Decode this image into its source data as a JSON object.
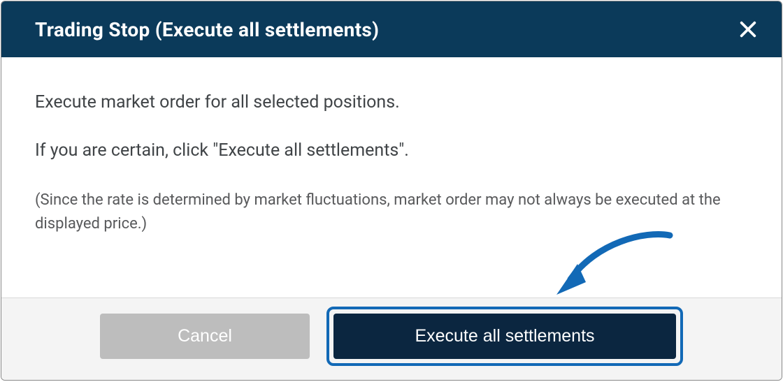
{
  "dialog": {
    "title": "Trading Stop (Execute all settlements)",
    "body": {
      "line1": "Execute market order for all selected positions.",
      "line2": "If you are certain, click \"Execute all settlements\".",
      "note": "(Since the rate is determined by market fluctuations, market order may not always be executed at the displayed price.)"
    },
    "footer": {
      "cancel": "Cancel",
      "confirm": "Execute all settlements"
    }
  },
  "colors": {
    "header_bg": "#0b3a5a",
    "primary_btn_bg": "#0b2640",
    "highlight_border": "#1269b6",
    "arrow": "#1269b6"
  }
}
